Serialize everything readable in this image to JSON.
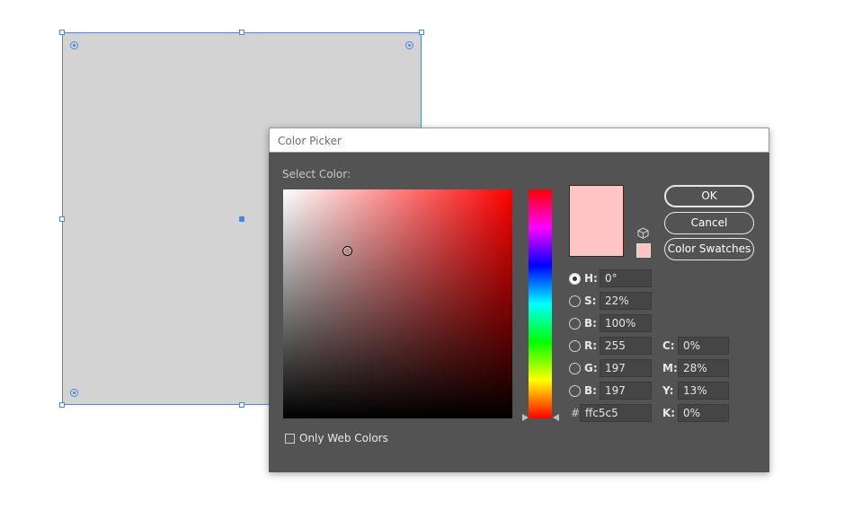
{
  "dialog": {
    "title": "Color Picker",
    "select_color_label": "Select Color:",
    "buttons": {
      "ok": "OK",
      "cancel": "Cancel",
      "swatches": "Color Swatches"
    },
    "hsb": {
      "h_label": "H:",
      "h_value": "0°",
      "s_label": "S:",
      "s_value": "22%",
      "b_label": "B:",
      "b_value": "100%"
    },
    "rgb": {
      "r_label": "R:",
      "r_value": "255",
      "g_label": "G:",
      "g_value": "197",
      "b_label": "B:",
      "b_value": "197"
    },
    "cmyk": {
      "c_label": "C:",
      "c_value": "0%",
      "m_label": "M:",
      "m_value": "28%",
      "y_label": "Y:",
      "y_value": "13%",
      "k_label": "K:",
      "k_value": "0%"
    },
    "hex_prefix": "#",
    "hex_value": "ffc5c5",
    "only_web_colors_label": "Only Web Colors",
    "only_web_colors_checked": false,
    "selected_mode": "H",
    "current_color": "#ffc5c5"
  },
  "icons": {
    "cube": "cube-icon",
    "radio": "radio-button",
    "checkbox": "checkbox"
  },
  "colors": {
    "selection_blue": "#4a86e8",
    "dialog_bg": "#535353",
    "field_bg": "#454545",
    "artboard_fill": "#d3d3d3"
  }
}
